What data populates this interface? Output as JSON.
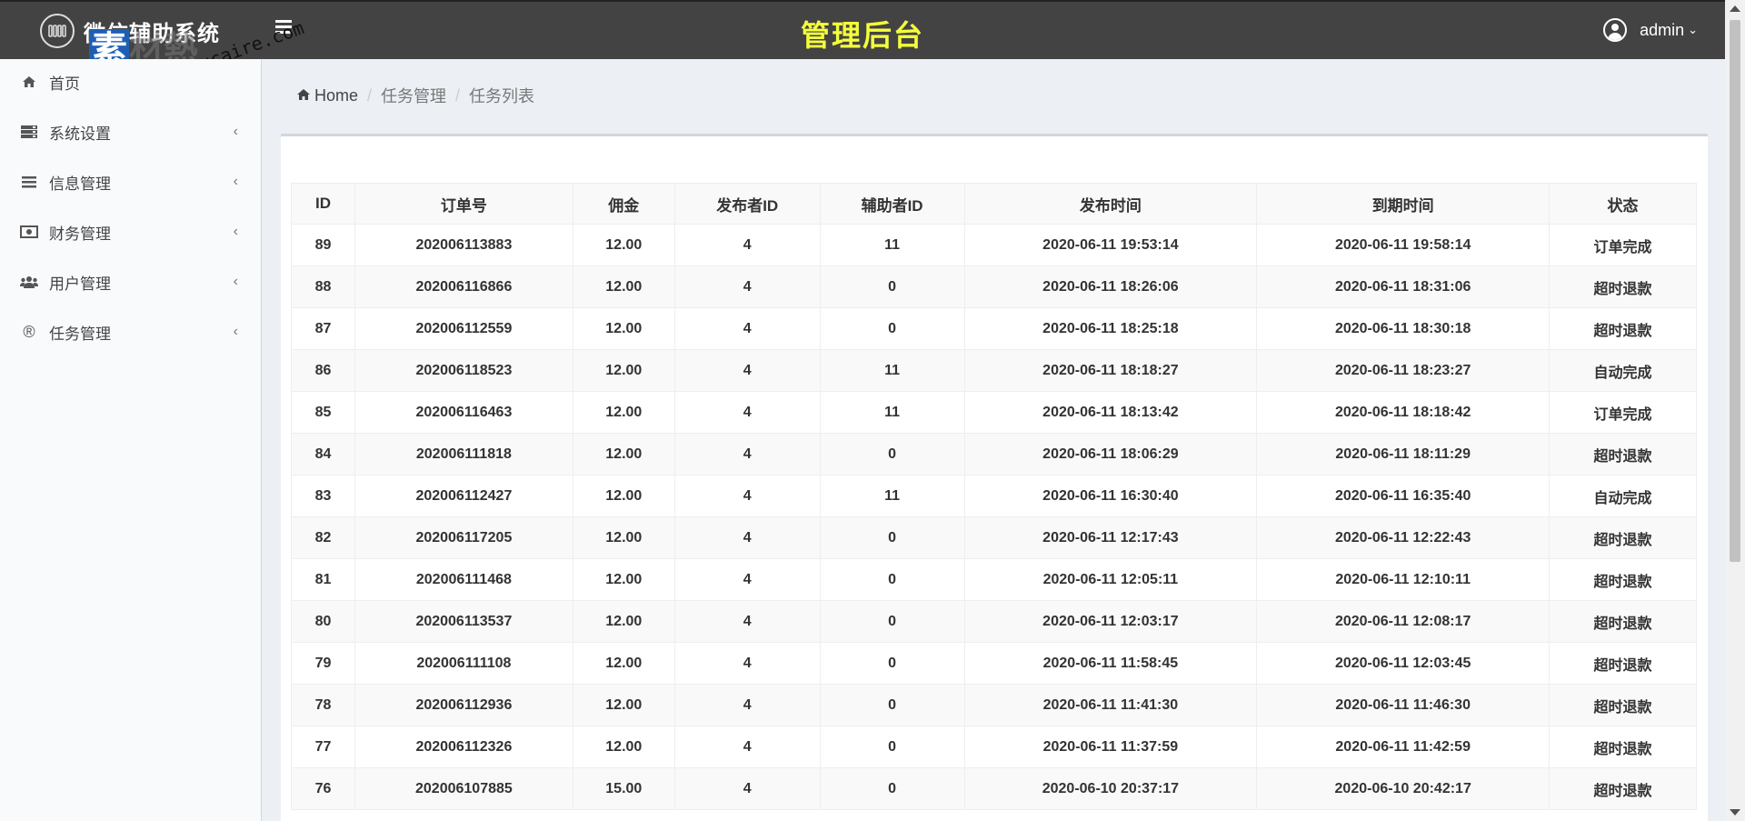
{
  "header": {
    "app_name": "微信辅助系统",
    "page_title": "管理后台",
    "user_name": "admin"
  },
  "watermark": {
    "block_text": "素",
    "gray_text": "材熱",
    "url": "sucaire.com"
  },
  "sidebar": {
    "items": [
      {
        "label": "首页",
        "icon": "home-icon",
        "has_submenu": false
      },
      {
        "label": "系统设置",
        "icon": "server-icon",
        "has_submenu": true
      },
      {
        "label": "信息管理",
        "icon": "list-icon",
        "has_submenu": true
      },
      {
        "label": "财务管理",
        "icon": "money-icon",
        "has_submenu": true
      },
      {
        "label": "用户管理",
        "icon": "users-icon",
        "has_submenu": true
      },
      {
        "label": "任务管理",
        "icon": "registered-icon",
        "has_submenu": true
      }
    ]
  },
  "breadcrumb": {
    "home": "Home",
    "level1": "任务管理",
    "level2": "任务列表"
  },
  "table": {
    "columns": [
      "ID",
      "订单号",
      "佣金",
      "发布者ID",
      "辅助者ID",
      "发布时间",
      "到期时间",
      "状态"
    ],
    "rows": [
      [
        "89",
        "202006113883",
        "12.00",
        "4",
        "11",
        "2020-06-11 19:53:14",
        "2020-06-11 19:58:14",
        "订单完成"
      ],
      [
        "88",
        "202006116866",
        "12.00",
        "4",
        "0",
        "2020-06-11 18:26:06",
        "2020-06-11 18:31:06",
        "超时退款"
      ],
      [
        "87",
        "202006112559",
        "12.00",
        "4",
        "0",
        "2020-06-11 18:25:18",
        "2020-06-11 18:30:18",
        "超时退款"
      ],
      [
        "86",
        "202006118523",
        "12.00",
        "4",
        "11",
        "2020-06-11 18:18:27",
        "2020-06-11 18:23:27",
        "自动完成"
      ],
      [
        "85",
        "202006116463",
        "12.00",
        "4",
        "11",
        "2020-06-11 18:13:42",
        "2020-06-11 18:18:42",
        "订单完成"
      ],
      [
        "84",
        "202006111818",
        "12.00",
        "4",
        "0",
        "2020-06-11 18:06:29",
        "2020-06-11 18:11:29",
        "超时退款"
      ],
      [
        "83",
        "202006112427",
        "12.00",
        "4",
        "11",
        "2020-06-11 16:30:40",
        "2020-06-11 16:35:40",
        "自动完成"
      ],
      [
        "82",
        "202006117205",
        "12.00",
        "4",
        "0",
        "2020-06-11 12:17:43",
        "2020-06-11 12:22:43",
        "超时退款"
      ],
      [
        "81",
        "202006111468",
        "12.00",
        "4",
        "0",
        "2020-06-11 12:05:11",
        "2020-06-11 12:10:11",
        "超时退款"
      ],
      [
        "80",
        "202006113537",
        "12.00",
        "4",
        "0",
        "2020-06-11 12:03:17",
        "2020-06-11 12:08:17",
        "超时退款"
      ],
      [
        "79",
        "202006111108",
        "12.00",
        "4",
        "0",
        "2020-06-11 11:58:45",
        "2020-06-11 12:03:45",
        "超时退款"
      ],
      [
        "78",
        "202006112936",
        "12.00",
        "4",
        "0",
        "2020-06-11 11:41:30",
        "2020-06-11 11:46:30",
        "超时退款"
      ],
      [
        "77",
        "202006112326",
        "12.00",
        "4",
        "0",
        "2020-06-11 11:37:59",
        "2020-06-11 11:42:59",
        "超时退款"
      ],
      [
        "76",
        "202006107885",
        "15.00",
        "4",
        "0",
        "2020-06-10 20:37:17",
        "2020-06-10 20:42:17",
        "超时退款"
      ]
    ]
  }
}
